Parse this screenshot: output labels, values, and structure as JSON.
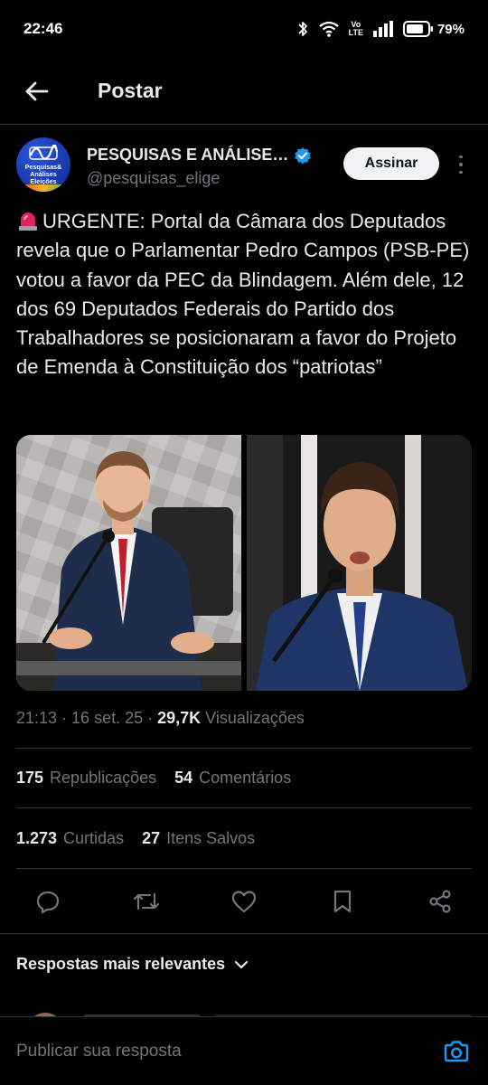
{
  "status_bar": {
    "time": "22:46",
    "network_label": "Vo LTE",
    "battery": "79%"
  },
  "header": {
    "title": "Postar",
    "back_icon": "arrow-left-icon"
  },
  "author": {
    "display_name": "PESQUISAS E ANÁLISE…",
    "handle": "@pesquisas_elige",
    "verified": true,
    "avatar_text": "Pesquisas&\nAnálises\nEleições",
    "follow_label": "Assinar"
  },
  "tweet": {
    "emoji": "🚨",
    "text": "URGENTE: Portal da Câmara dos Deputados revela que o Parlamentar Pedro Campos (PSB-PE) votou a favor da PEC da Blindagem. Além dele, 12 dos 69 Deputados Federais do Partido dos Trabalhadores se posicionaram a favor do Projeto de Emenda à Constituição dos “patriotas”",
    "media": [
      {
        "description": "Man in navy suit and red tie speaking at microphone"
      },
      {
        "description": "Young man in navy suit and tie speaking at microphone"
      }
    ]
  },
  "meta": {
    "time": "21:13",
    "date": "16 set. 25",
    "views_count": "29,7K",
    "views_label": "Visualizações"
  },
  "stats": {
    "reposts_count": "175",
    "reposts_label": "Republicações",
    "comments_count": "54",
    "comments_label": "Comentários",
    "likes_count": "1.273",
    "likes_label": "Curtidas",
    "saves_count": "27",
    "saves_label": "Itens Salvos"
  },
  "actions": [
    "reply-icon",
    "repost-icon",
    "like-icon",
    "bookmark-icon",
    "share-icon"
  ],
  "replies": {
    "sort_label": "Respostas mais relevantes"
  },
  "composer": {
    "placeholder": "Publicar sua resposta"
  },
  "colors": {
    "background": "#000000",
    "text_primary": "#e7e9ea",
    "text_secondary": "#71767b",
    "divider": "#2f3336",
    "accent": "#1d9bf0",
    "follow_bg": "#eff3f4"
  }
}
